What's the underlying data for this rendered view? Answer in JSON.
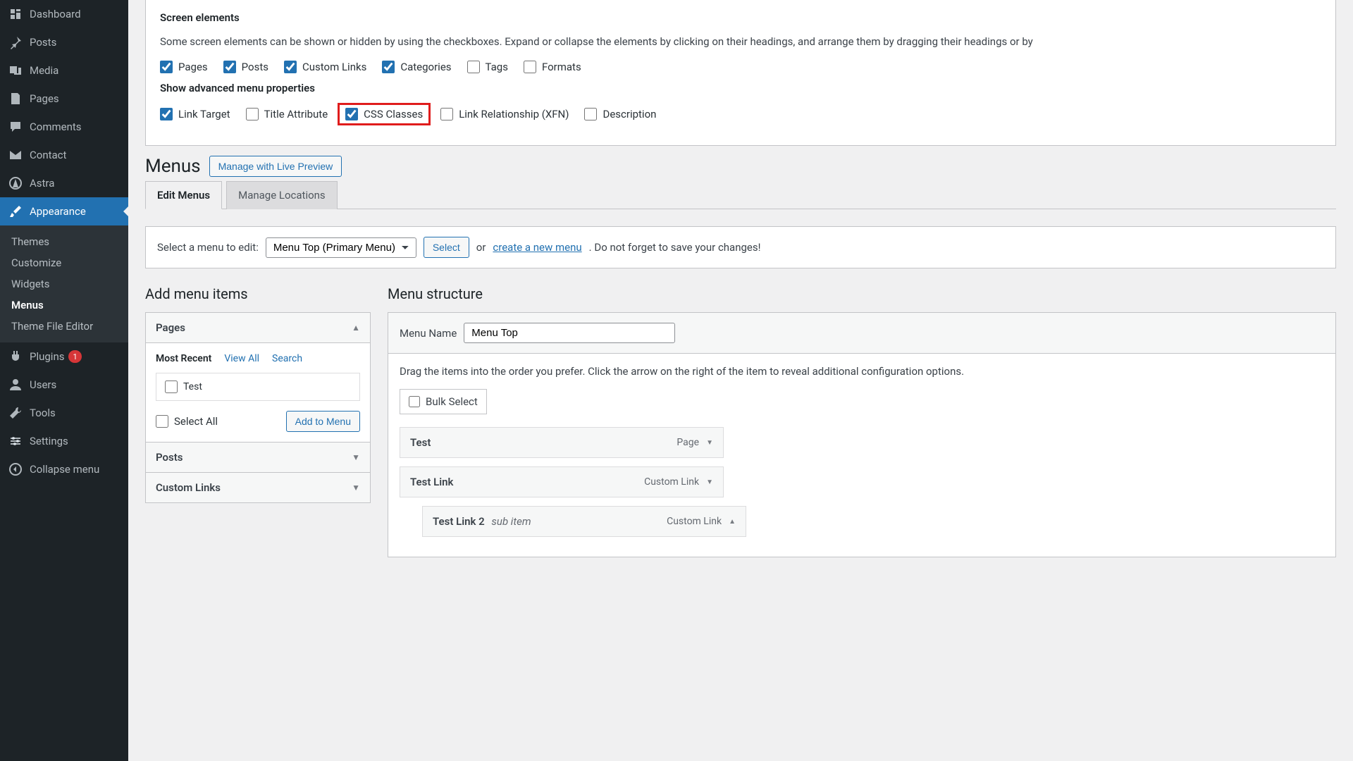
{
  "sidebar": {
    "items": [
      {
        "label": "Dashboard"
      },
      {
        "label": "Posts"
      },
      {
        "label": "Media"
      },
      {
        "label": "Pages"
      },
      {
        "label": "Comments"
      },
      {
        "label": "Contact"
      },
      {
        "label": "Astra"
      },
      {
        "label": "Appearance"
      },
      {
        "label": "Plugins",
        "badge": "1"
      },
      {
        "label": "Users"
      },
      {
        "label": "Tools"
      },
      {
        "label": "Settings"
      },
      {
        "label": "Collapse menu"
      }
    ],
    "appearance_sub": [
      {
        "label": "Themes"
      },
      {
        "label": "Customize"
      },
      {
        "label": "Widgets"
      },
      {
        "label": "Menus"
      },
      {
        "label": "Theme File Editor"
      }
    ]
  },
  "screen_options": {
    "heading1": "Screen elements",
    "desc": "Some screen elements can be shown or hidden by using the checkboxes. Expand or collapse the elements by clicking on their headings, and arrange them by dragging their headings or by ",
    "boxes": [
      {
        "label": "Pages",
        "checked": true
      },
      {
        "label": "Posts",
        "checked": true
      },
      {
        "label": "Custom Links",
        "checked": true
      },
      {
        "label": "Categories",
        "checked": true
      },
      {
        "label": "Tags",
        "checked": false
      },
      {
        "label": "Formats",
        "checked": false
      }
    ],
    "heading2": "Show advanced menu properties",
    "adv": [
      {
        "label": "Link Target",
        "checked": true
      },
      {
        "label": "Title Attribute",
        "checked": false
      },
      {
        "label": "CSS Classes",
        "checked": true,
        "highlight": true
      },
      {
        "label": "Link Relationship (XFN)",
        "checked": false
      },
      {
        "label": "Description",
        "checked": false
      }
    ]
  },
  "page": {
    "title": "Menus",
    "live_preview": "Manage with Live Preview",
    "tabs": [
      {
        "label": "Edit Menus",
        "active": true
      },
      {
        "label": "Manage Locations",
        "active": false
      }
    ]
  },
  "select_bar": {
    "prompt": "Select a menu to edit:",
    "selected": "Menu Top (Primary Menu)",
    "select_btn": "Select",
    "or": "or",
    "create_link": "create a new menu",
    "tail": ". Do not forget to save your changes!"
  },
  "add_items": {
    "heading": "Add menu items",
    "pages": {
      "title": "Pages",
      "tabs": {
        "recent": "Most Recent",
        "view_all": "View All",
        "search": "Search"
      },
      "items": [
        {
          "label": "Test"
        }
      ],
      "select_all": "Select All",
      "add_btn": "Add to Menu"
    },
    "posts_title": "Posts",
    "custom_links_title": "Custom Links"
  },
  "structure": {
    "heading": "Menu structure",
    "name_label": "Menu Name",
    "name_value": "Menu Top",
    "instructions": "Drag the items into the order you prefer. Click the arrow on the right of the item to reveal additional configuration options.",
    "bulk_select": "Bulk Select",
    "items": [
      {
        "title": "Test",
        "type": "Page",
        "indent": false,
        "up": false
      },
      {
        "title": "Test Link",
        "type": "Custom Link",
        "indent": false,
        "up": false
      },
      {
        "title": "Test Link 2",
        "sub": "sub item",
        "type": "Custom Link",
        "indent": true,
        "up": true
      }
    ]
  }
}
